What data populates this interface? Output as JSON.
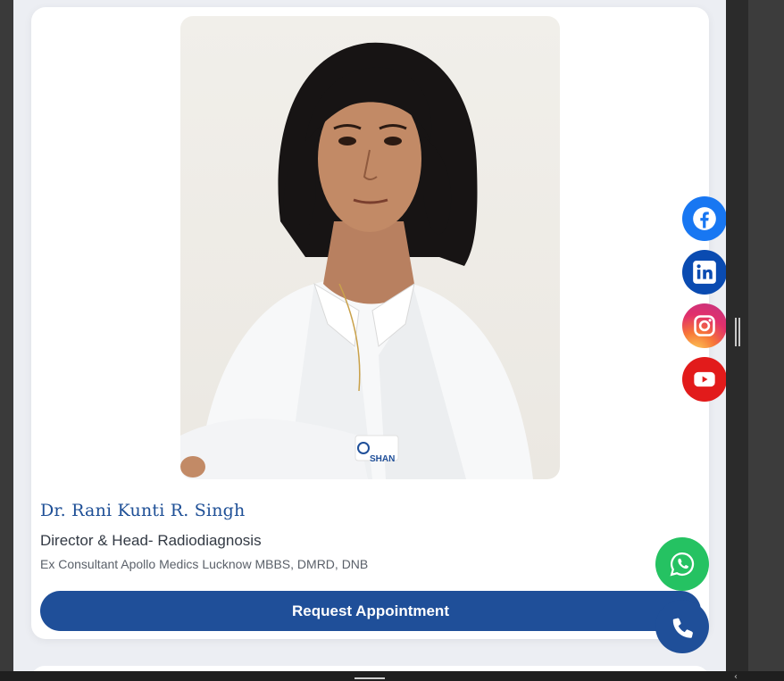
{
  "doctor": {
    "name": "Dr. Rani Kunti R. Singh",
    "role": "Director & Head- Radiodiagnosis",
    "qualifications": "Ex Consultant Apollo Medics Lucknow MBBS, DMRD, DNB",
    "photo_badge": "SHAN"
  },
  "cta": {
    "label": "Request Appointment"
  },
  "social": [
    {
      "name": "facebook-icon",
      "color": "#1877f2"
    },
    {
      "name": "linkedin-icon",
      "color": "#0a4bb1"
    },
    {
      "name": "instagram-icon",
      "color": "#e1306c"
    },
    {
      "name": "youtube-icon",
      "color": "#e21b1b"
    }
  ],
  "floating": [
    {
      "name": "whatsapp-icon",
      "color": "#25c262"
    },
    {
      "name": "phone-icon",
      "color": "#1f4f99"
    }
  ],
  "colors": {
    "accent": "#1f4f99",
    "name_text": "#1e4f96",
    "background": "#eceef3"
  }
}
